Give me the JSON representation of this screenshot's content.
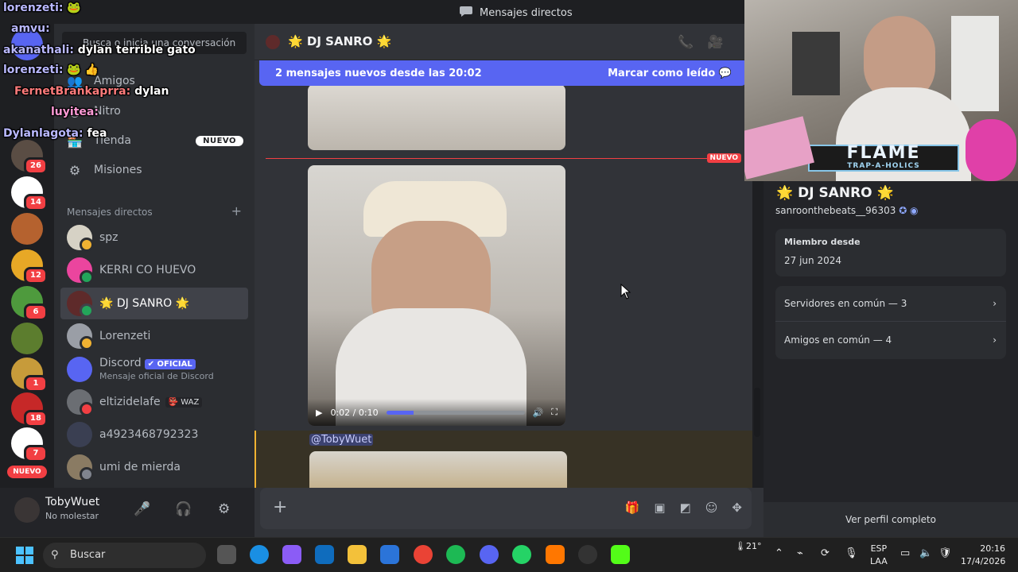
{
  "window": {
    "title": "Mensajes directos"
  },
  "rail": {
    "badges": [
      "26",
      "14",
      "12",
      "6",
      "1",
      "18",
      "7"
    ],
    "new_label": "NUEVO"
  },
  "dm_column": {
    "search_placeholder": "Busca o inicia una conversación",
    "nav": [
      {
        "label": "Amigos",
        "icon": "friends-icon"
      },
      {
        "label": "Nitro",
        "icon": "nitro-icon"
      },
      {
        "label": "Tienda",
        "icon": "shop-icon",
        "pill": "NUEVO"
      },
      {
        "label": "Misiones",
        "icon": "quests-icon"
      }
    ],
    "section_title": "Mensajes directos",
    "add_icon": "+",
    "dms": [
      {
        "name": "spz"
      },
      {
        "name": "KERRI CO HUEVO"
      },
      {
        "name": "🌟 DJ SANRO 🌟"
      },
      {
        "name": "Lorenzeti"
      },
      {
        "name": "Discord",
        "tag": "✔ OFICIAL",
        "sub": "Mensaje oficial de Discord"
      },
      {
        "name": "eltizidelafe",
        "tag": "👺 WAZ"
      },
      {
        "name": "a4923468792323"
      },
      {
        "name": "umi de mierda"
      }
    ]
  },
  "user_panel": {
    "username": "TobyWuet",
    "status": "No molestar"
  },
  "chat_header": {
    "name": "🌟 DJ SANRO 🌟"
  },
  "chat": {
    "banner_text": "2 mensajes nuevos desde las 20:02",
    "banner_action": "Marcar como leído",
    "new_marker": "NUEVO",
    "video": {
      "time": "0:02 / 0:10",
      "progress": 0.2
    },
    "mention": "@TobyWuet"
  },
  "composer": {
    "plus": "+"
  },
  "profile": {
    "display_name": "🌟 DJ SANRO 🌟",
    "username": "sanroonthebeats__96303",
    "member_since_label": "Miembro desde",
    "member_since": "27 jun 2024",
    "servers_common": "Servidores en común — 3",
    "friends_common": "Amigos en común — 4",
    "view_full": "Ver perfil completo"
  },
  "overlay": {
    "lines": [
      {
        "user": "lorenzeti:",
        "msg": "🐸"
      },
      {
        "user": "amvu:",
        "msg": ""
      },
      {
        "user": "akanathali:",
        "msg": "dylan terrible gato"
      },
      {
        "user": "lorenzeti:",
        "msg": "🐸 👍"
      },
      {
        "user": "FernetBrankaprra:",
        "msg": "dylan"
      },
      {
        "user": "luyitea:",
        "msg": ""
      },
      {
        "user": "Dylanlagota:",
        "msg": "fea"
      }
    ]
  },
  "webcam_banner": {
    "title": "FLAME",
    "subtitle": "TRAP-A-HOLICS"
  },
  "taskbar": {
    "search": "Buscar",
    "weather": "21°",
    "lang": "ESP",
    "lang_sub": "LAA",
    "time": "20:16",
    "date": "17/4/2026"
  },
  "colors": {
    "accent": "#5865f2",
    "danger": "#f23f43",
    "online": "#23a55a",
    "dnd": "#f23f43"
  }
}
